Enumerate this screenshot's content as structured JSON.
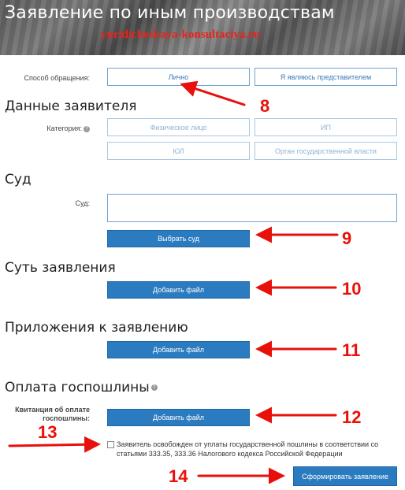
{
  "header": {
    "title": "Заявление по иным производствам",
    "watermark": "yuridicheskaya-konsultaciya.ru"
  },
  "appeal": {
    "label": "Способ обращения:",
    "options": [
      "Лично",
      "Я являюсь представителем"
    ]
  },
  "applicant": {
    "title": "Данные заявителя",
    "category_label": "Категория:",
    "options": [
      "Физическое лицо",
      "ИП",
      "ЮЛ",
      "Орган государственной власти"
    ]
  },
  "court": {
    "title": "Суд",
    "field_label": "Суд:",
    "field_value": "",
    "select_button": "Выбрать суд"
  },
  "essence": {
    "title": "Суть заявления",
    "add_file": "Добавить файл"
  },
  "attachments": {
    "title": "Приложения к заявлению",
    "add_file": "Добавить файл"
  },
  "fee": {
    "title": "Оплата госпошлины",
    "receipt_label": "Квитанция об оплате госпошлины:",
    "add_file": "Добавить файл",
    "exempt_text": "Заявитель освобожден от уплаты государственной пошлины в соответствии со статьями 333.35, 333.36 Налогового кодекса Российской Федерации",
    "exempt_checked": false
  },
  "submit_label": "Сформировать заявление",
  "annotations": {
    "colors": {
      "arrow": "#e8100a"
    },
    "numbers": [
      "8",
      "9",
      "10",
      "11",
      "12",
      "13",
      "14"
    ]
  }
}
